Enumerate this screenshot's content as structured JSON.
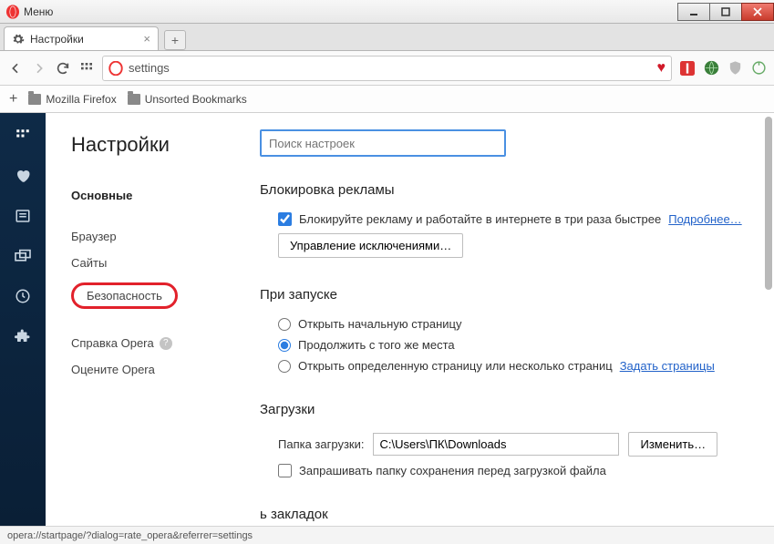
{
  "window": {
    "menu_label": "Меню"
  },
  "tabs": {
    "active": {
      "label": "Настройки"
    }
  },
  "omnibox": {
    "url": "settings"
  },
  "bookmarks_bar": {
    "folder1": "Mozilla Firefox",
    "folder2": "Unsorted Bookmarks"
  },
  "sidebar": {
    "title": "Настройки",
    "items": {
      "main": "Основные",
      "browser": "Браузер",
      "sites": "Сайты",
      "security": "Безопасность",
      "help": "Справка Opera",
      "rate": "Оцените Opera"
    }
  },
  "content": {
    "search_placeholder": "Поиск настроек",
    "adblock": {
      "heading": "Блокировка рекламы",
      "checkbox_label": "Блокируйте рекламу и работайте в интернете в три раза быстрее",
      "more_link": "Подробнее…",
      "exceptions_btn": "Управление исключениями…"
    },
    "startup": {
      "heading": "При запуске",
      "opt_start": "Открыть начальную страницу",
      "opt_continue": "Продолжить с того же места",
      "opt_specific": "Открыть определенную страницу или несколько страниц",
      "set_pages_link": "Задать страницы"
    },
    "downloads": {
      "heading": "Загрузки",
      "folder_label": "Папка загрузки:",
      "folder_value": "C:\\Users\\ПК\\Downloads",
      "change_btn": "Изменить…",
      "ask_checkbox": "Запрашивать папку сохранения перед загрузкой файла"
    },
    "bookmarks_panel": {
      "heading_partial": "ь закладок"
    }
  },
  "statusbar": {
    "text": "opera://startpage/?dialog=rate_opera&referrer=settings"
  }
}
